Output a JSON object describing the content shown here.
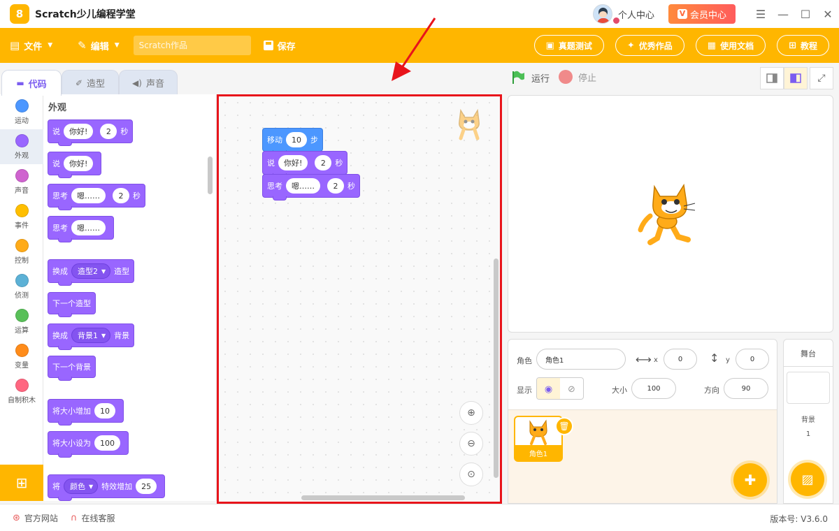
{
  "app": {
    "title": "Scratch少儿编程学堂",
    "logo_glyph": "8",
    "personal_center": "个人中心",
    "vip_label": "会员中心",
    "vip_glyph": "V",
    "window_controls": [
      "☰",
      "—",
      "☐",
      "✕"
    ]
  },
  "toolbar": {
    "file_label": "文件",
    "edit_label": "编辑",
    "project_placeholder": "Scratch作品",
    "save_label": "保存",
    "buttons": [
      "真题测试",
      "优秀作品",
      "使用文档",
      "教程"
    ]
  },
  "tabs": [
    "代码",
    "造型",
    "声音"
  ],
  "categories": [
    {
      "label": "运动",
      "color": "#4c97ff"
    },
    {
      "label": "外观",
      "color": "#9966ff"
    },
    {
      "label": "声音",
      "color": "#cf63cf"
    },
    {
      "label": "事件",
      "color": "#ffbf00"
    },
    {
      "label": "控制",
      "color": "#ffab19"
    },
    {
      "label": "侦测",
      "color": "#5cb1d6"
    },
    {
      "label": "运算",
      "color": "#59c059"
    },
    {
      "label": "变量",
      "color": "#ff8c1a"
    },
    {
      "label": "自制积木",
      "color": "#ff6680"
    }
  ],
  "palette": {
    "section_title": "外观",
    "say_secs": {
      "prefix": "说",
      "text": "你好!",
      "num": "2",
      "suffix": "秒"
    },
    "say": {
      "prefix": "说",
      "text": "你好!"
    },
    "think_secs": {
      "prefix": "思考",
      "text": "嗯……",
      "num": "2",
      "suffix": "秒"
    },
    "think": {
      "prefix": "思考",
      "text": "嗯……"
    },
    "switch_costume": {
      "prefix": "换成",
      "menu": "造型2",
      "suffix": "造型"
    },
    "next_costume": "下一个造型",
    "switch_backdrop": {
      "prefix": "换成",
      "menu": "背景1",
      "suffix": "背景"
    },
    "next_backdrop": "下一个背景",
    "change_size": {
      "prefix": "将大小增加",
      "num": "10"
    },
    "set_size": {
      "prefix": "将大小设为",
      "num": "100"
    },
    "change_effect": {
      "prefix": "将",
      "menu": "颜色",
      "mid": "特效增加",
      "num": "25"
    }
  },
  "workspace": {
    "move": {
      "prefix": "移动",
      "num": "10",
      "suffix": "步"
    },
    "say_secs": {
      "prefix": "说",
      "text": "你好!",
      "num": "2",
      "suffix": "秒"
    },
    "think_secs": {
      "prefix": "思考",
      "text": "嗯……",
      "num": "2",
      "suffix": "秒"
    }
  },
  "stage_controls": {
    "run_label": "运行",
    "stop_label": "停止"
  },
  "sprite_info": {
    "sprite_label": "角色",
    "sprite_name": "角色1",
    "x_label": "x",
    "x_value": "0",
    "y_label": "y",
    "y_value": "0",
    "show_label": "显示",
    "size_label": "大小",
    "size_value": "100",
    "direction_label": "方向",
    "direction_value": "90",
    "thumbnail_name": "角色1"
  },
  "stage_panel": {
    "title": "舞台",
    "backdrop_label": "背景",
    "backdrop_count": "1"
  },
  "status": {
    "official_site": "官方网站",
    "support": "在线客服",
    "version": "版本号: V3.6.0"
  },
  "colors": {
    "accent": "#ffb600",
    "looks": "#9966ff",
    "motion": "#4c97ff",
    "highlight_border": "#e8141b"
  }
}
